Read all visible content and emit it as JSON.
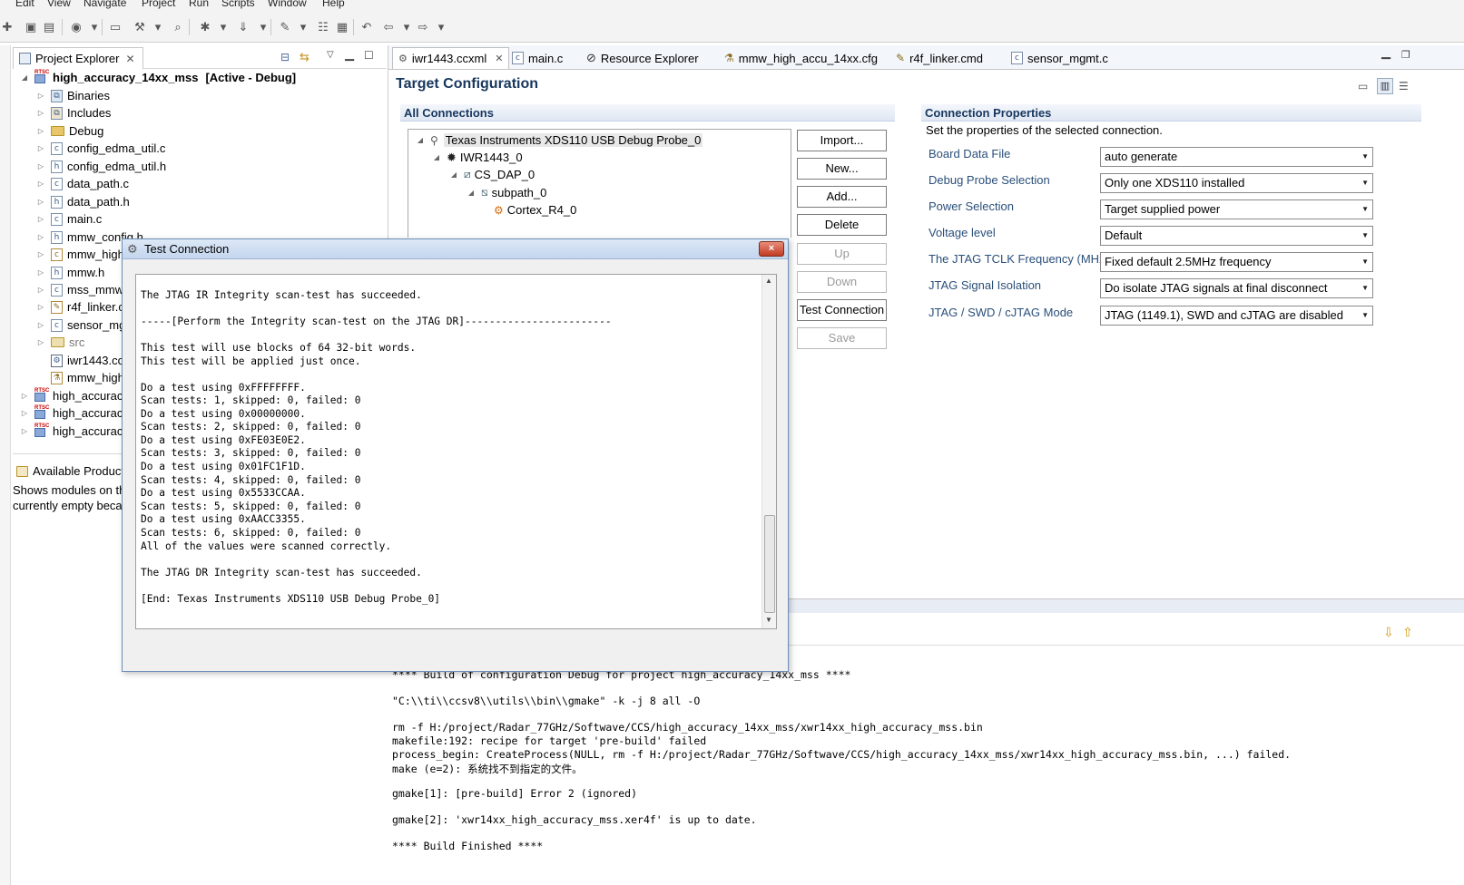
{
  "menubar": [
    "Edit",
    "View",
    "Navigate",
    "Project",
    "Run",
    "Scripts",
    "Window",
    "Help"
  ],
  "left": {
    "project_explorer_tab": "Project Explorer",
    "root_project": "high_accuracy_14xx_mss",
    "root_status": "[Active - Debug]",
    "items": [
      {
        "label": "Binaries",
        "icon": "binaries-icon"
      },
      {
        "label": "Includes",
        "icon": "includes-icon"
      },
      {
        "label": "Debug",
        "icon": "folder-icon"
      },
      {
        "label": "config_edma_util.c",
        "icon": "c-file-icon"
      },
      {
        "label": "config_edma_util.h",
        "icon": "h-file-icon"
      },
      {
        "label": "data_path.c",
        "icon": "c-file-icon"
      },
      {
        "label": "data_path.h",
        "icon": "h-file-icon"
      },
      {
        "label": "main.c",
        "icon": "c-file-icon"
      },
      {
        "label": "mmw_config.h",
        "icon": "h-file-icon"
      },
      {
        "label": "mmw_high",
        "icon": "cfg-file-icon"
      },
      {
        "label": "mmw.h",
        "icon": "h-file-icon"
      },
      {
        "label": "mss_mmw_",
        "icon": "c-file-icon"
      },
      {
        "label": "r4f_linker.c",
        "icon": "cmd-file-icon"
      },
      {
        "label": "sensor_mg",
        "icon": "c-file-icon"
      },
      {
        "label": "src",
        "icon": "folder-icon"
      },
      {
        "label": "iwr1443.cc",
        "icon": "ccxml-file-icon"
      },
      {
        "label": "mmw_high",
        "icon": "cfg-file-icon"
      }
    ],
    "other_projects": [
      "high_accuracy",
      "high_accuracy",
      "high_accuracy"
    ],
    "available_products_tab": "Available Product",
    "available_text_1": "Shows modules on th",
    "available_text_2": "currently empty beca"
  },
  "editor": {
    "tabs": [
      "iwr1443.ccxml",
      "main.c",
      "Resource Explorer",
      "mmw_high_accu_14xx.cfg",
      "r4f_linker.cmd",
      "sensor_mgmt.c"
    ],
    "title": "Target Configuration",
    "all_connections": "All Connections",
    "tree": [
      "Texas Instruments XDS110 USB Debug Probe_0",
      "IWR1443_0",
      "CS_DAP_0",
      "subpath_0",
      "Cortex_R4_0"
    ],
    "buttons": {
      "import": "Import...",
      "new": "New...",
      "add": "Add...",
      "delete": "Delete",
      "up": "Up",
      "down": "Down",
      "test_connection": "Test Connection",
      "save": "Save"
    },
    "connection_properties": "Connection Properties",
    "connection_desc": "Set the properties of the selected connection.",
    "properties": [
      {
        "label": "Board Data File",
        "value": "auto generate"
      },
      {
        "label": "Debug Probe Selection",
        "value": "Only one XDS110 installed"
      },
      {
        "label": "Power Selection",
        "value": "Target supplied power"
      },
      {
        "label": "Voltage level",
        "value": "Default"
      },
      {
        "label": "The JTAG TCLK Frequency (MHz)",
        "value": "Fixed default 2.5MHz frequency"
      },
      {
        "label": "JTAG Signal Isolation",
        "value": "Do isolate JTAG signals at final disconnect"
      },
      {
        "label": "JTAG / SWD / cJTAG Mode",
        "value": "JTAG (1149.1), SWD and cJTAG are disabled"
      }
    ]
  },
  "dialog": {
    "title": "Test Connection",
    "close": "×",
    "lines": [
      "The JTAG IR Integrity scan-test has succeeded.",
      "",
      "-----[Perform the Integrity scan-test on the JTAG DR]------------------------",
      "",
      "This test will use blocks of 64 32-bit words.",
      "This test will be applied just once.",
      "",
      "Do a test using 0xFFFFFFFF.",
      "Scan tests: 1, skipped: 0, failed: 0",
      "Do a test using 0x00000000.",
      "Scan tests: 2, skipped: 0, failed: 0",
      "Do a test using 0xFE03E0E2.",
      "Scan tests: 3, skipped: 0, failed: 0",
      "Do a test using 0x01FC1F1D.",
      "Scan tests: 4, skipped: 0, failed: 0",
      "Do a test using 0x5533CCAA.",
      "Scan tests: 5, skipped: 0, failed: 0",
      "Do a test using 0xAACC3355.",
      "Scan tests: 6, skipped: 0, failed: 0",
      "All of the values were scanned correctly.",
      "",
      "The JTAG DR Integrity scan-test has succeeded.",
      "",
      "[End: Texas Instruments XDS110 USB Debug Probe_0]"
    ]
  },
  "console": {
    "lines": [
      "**** Build of configuration Debug for project high_accuracy_14xx_mss ****",
      "",
      "\"C:\\\\ti\\\\ccsv8\\\\utils\\\\bin\\\\gmake\" -k -j 8 all -O",
      "",
      "rm -f H:/project/Radar_77GHz/Softwave/CCS/high_accuracy_14xx_mss/xwr14xx_high_accuracy_mss.bin",
      "makefile:192: recipe for target 'pre-build' failed",
      "process_begin: CreateProcess(NULL, rm -f H:/project/Radar_77GHz/Softwave/CCS/high_accuracy_14xx_mss/xwr14xx_high_accuracy_mss.bin, ...) failed.",
      "make (e=2): 系统找不到指定的文件。",
      "",
      "gmake[1]: [pre-build] Error 2 (ignored)",
      "",
      "gmake[2]: 'xwr14xx_high_accuracy_mss.xer4f' is up to date.",
      "",
      "**** Build Finished ****"
    ]
  }
}
